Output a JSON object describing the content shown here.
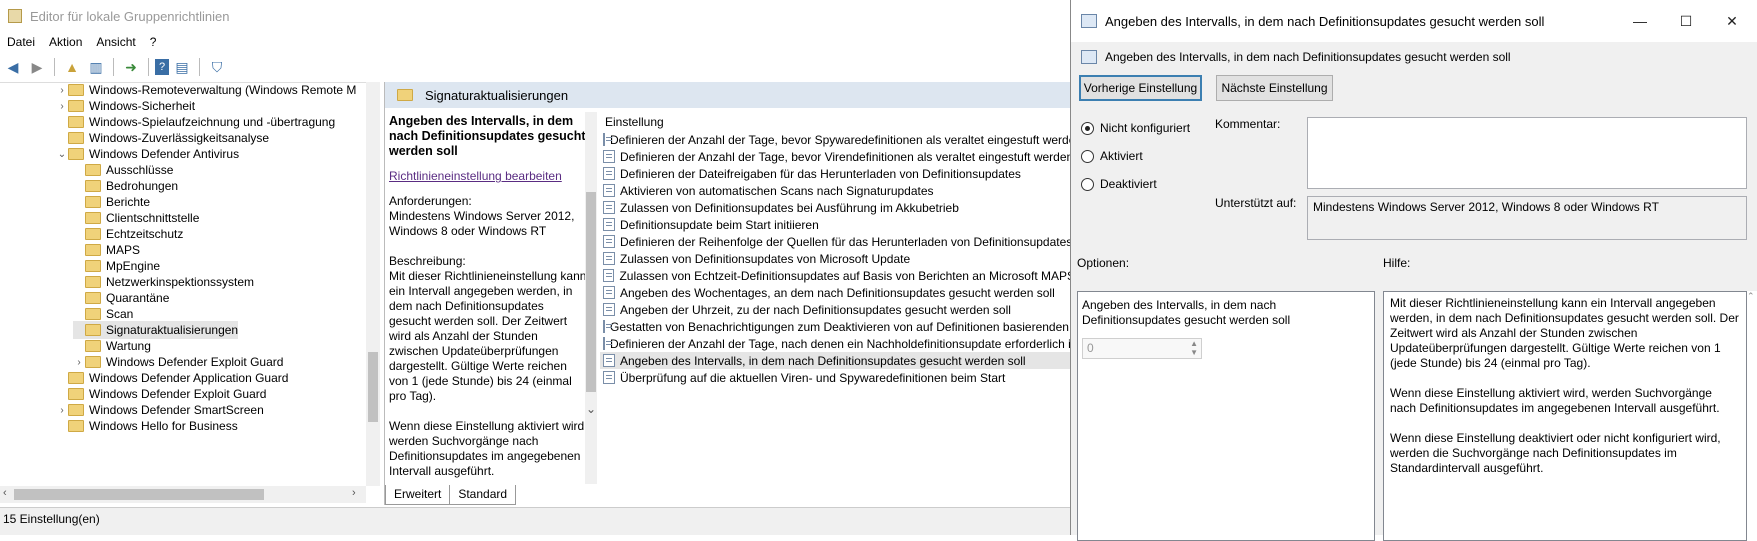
{
  "main": {
    "title": "Editor für lokale Gruppenrichtlinien",
    "menu": [
      "Datei",
      "Aktion",
      "Ansicht",
      "?"
    ],
    "tree": [
      {
        "label": "Windows-Remoteverwaltung (Windows Remote M",
        "level": 1,
        "expander": ">"
      },
      {
        "label": "Windows-Sicherheit",
        "level": 1,
        "expander": ">"
      },
      {
        "label": "Windows-Spielaufzeichnung und -übertragung",
        "level": 1,
        "expander": ""
      },
      {
        "label": "Windows-Zuverlässigkeitsanalyse",
        "level": 1,
        "expander": ""
      },
      {
        "label": "Windows Defender Antivirus",
        "level": 1,
        "expander": "v"
      },
      {
        "label": "Ausschlüsse",
        "level": 2,
        "expander": ""
      },
      {
        "label": "Bedrohungen",
        "level": 2,
        "expander": ""
      },
      {
        "label": "Berichte",
        "level": 2,
        "expander": ""
      },
      {
        "label": "Clientschnittstelle",
        "level": 2,
        "expander": ""
      },
      {
        "label": "Echtzeitschutz",
        "level": 2,
        "expander": ""
      },
      {
        "label": "MAPS",
        "level": 2,
        "expander": ""
      },
      {
        "label": "MpEngine",
        "level": 2,
        "expander": ""
      },
      {
        "label": "Netzwerkinspektionssystem",
        "level": 2,
        "expander": ""
      },
      {
        "label": "Quarantäne",
        "level": 2,
        "expander": ""
      },
      {
        "label": "Scan",
        "level": 2,
        "expander": ""
      },
      {
        "label": "Signaturaktualisierungen",
        "level": 2,
        "expander": "",
        "selected": true
      },
      {
        "label": "Wartung",
        "level": 2,
        "expander": ""
      },
      {
        "label": "Windows Defender Exploit Guard",
        "level": 2,
        "expander": ">"
      },
      {
        "label": "Windows Defender Application Guard",
        "level": 1,
        "expander": ""
      },
      {
        "label": "Windows Defender Exploit Guard",
        "level": 1,
        "expander": ""
      },
      {
        "label": "Windows Defender SmartScreen",
        "level": 1,
        "expander": ">"
      },
      {
        "label": "Windows Hello for Business",
        "level": 1,
        "expander": ""
      }
    ],
    "folder_header": "Signaturaktualisierungen",
    "description": {
      "title": "Angeben des Intervalls, in dem nach Definitionsupdates gesucht werden soll",
      "edit_link": "Richtlinieneinstellung bearbeiten",
      "requirements_label": "Anforderungen:",
      "requirements": "Mindestens Windows Server 2012, Windows 8 oder Windows RT",
      "description_label": "Beschreibung:",
      "description": "Mit dieser Richtlinieneinstellung kann ein Intervall angegeben werden, in dem nach Definitionsupdates gesucht werden soll. Der Zeitwert wird als Anzahl der Stunden zwischen Updateüberprüfungen dargestellt. Gültige Werte reichen von 1 (jede Stunde) bis 24 (einmal pro Tag).",
      "description2": "Wenn diese Einstellung aktiviert wird, werden Suchvorgänge nach Definitionsupdates im angegebenen Intervall ausgeführt."
    },
    "settings_header": "Einstellung",
    "settings": [
      "Definieren der Anzahl der Tage, bevor Spywaredefinitionen als veraltet eingestuft werden",
      "Definieren der Anzahl der Tage, bevor Virendefinitionen als veraltet eingestuft werden",
      "Definieren der Dateifreigaben für das Herunterladen von Definitionsupdates",
      "Aktivieren von automatischen Scans nach Signaturupdates",
      "Zulassen von Definitionsupdates bei Ausführung im Akkubetrieb",
      "Definitionsupdate beim Start initiieren",
      "Definieren der Reihenfolge der Quellen für das Herunterladen von Definitionsupdates",
      "Zulassen von Definitionsupdates von Microsoft Update",
      "Zulassen von Echtzeit-Definitionsupdates auf Basis von Berichten an Microsoft MAPS",
      "Angeben des Wochentages, an dem nach Definitionsupdates gesucht werden soll",
      "Angeben der Uhrzeit, zu der nach Definitionsupdates gesucht werden soll",
      "Gestatten von Benachrichtigungen zum Deaktivieren von auf Definitionen basierenden Berichten",
      "Definieren der Anzahl der Tage, nach denen ein Nachholdefinitionsupdate erforderlich ist",
      "Angeben des Intervalls, in dem nach Definitionsupdates gesucht werden soll",
      "Überprüfung auf die aktuellen Viren- und Spywaredefinitionen beim Start"
    ],
    "selected_setting_index": 13,
    "tabs": [
      "Erweitert",
      "Standard"
    ],
    "status": "15 Einstellung(en)"
  },
  "dialog": {
    "title": "Angeben des Intervalls, in dem nach Definitionsupdates gesucht werden soll",
    "subtitle": "Angeben des Intervalls, in dem nach Definitionsupdates gesucht werden soll",
    "prev_button": "Vorherige Einstellung",
    "next_button": "Nächste Einstellung",
    "radios": [
      "Nicht konfiguriert",
      "Aktiviert",
      "Deaktiviert"
    ],
    "selected_radio": "Nicht konfiguriert",
    "comment_label": "Kommentar:",
    "supported_label": "Unterstützt auf:",
    "supported_value": "Mindestens Windows Server 2012, Windows 8 oder Windows RT",
    "options_label": "Optionen:",
    "help_label": "Hilfe:",
    "option_text": "Angeben des Intervalls, in dem nach Definitionsupdates gesucht werden soll",
    "option_value": "0",
    "help_paragraphs": [
      "Mit dieser Richtlinieneinstellung kann ein Intervall angegeben werden, in dem nach Definitionsupdates gesucht werden soll. Der Zeitwert wird als Anzahl der Stunden zwischen Updateüberprüfungen dargestellt. Gültige Werte reichen von 1 (jede Stunde) bis 24 (einmal pro Tag).",
      "Wenn diese Einstellung aktiviert wird, werden Suchvorgänge nach Definitionsupdates im angegebenen Intervall ausgeführt.",
      "Wenn diese Einstellung deaktiviert oder nicht konfiguriert wird, werden die Suchvorgänge nach Definitionsupdates im Standardintervall ausgeführt."
    ]
  }
}
